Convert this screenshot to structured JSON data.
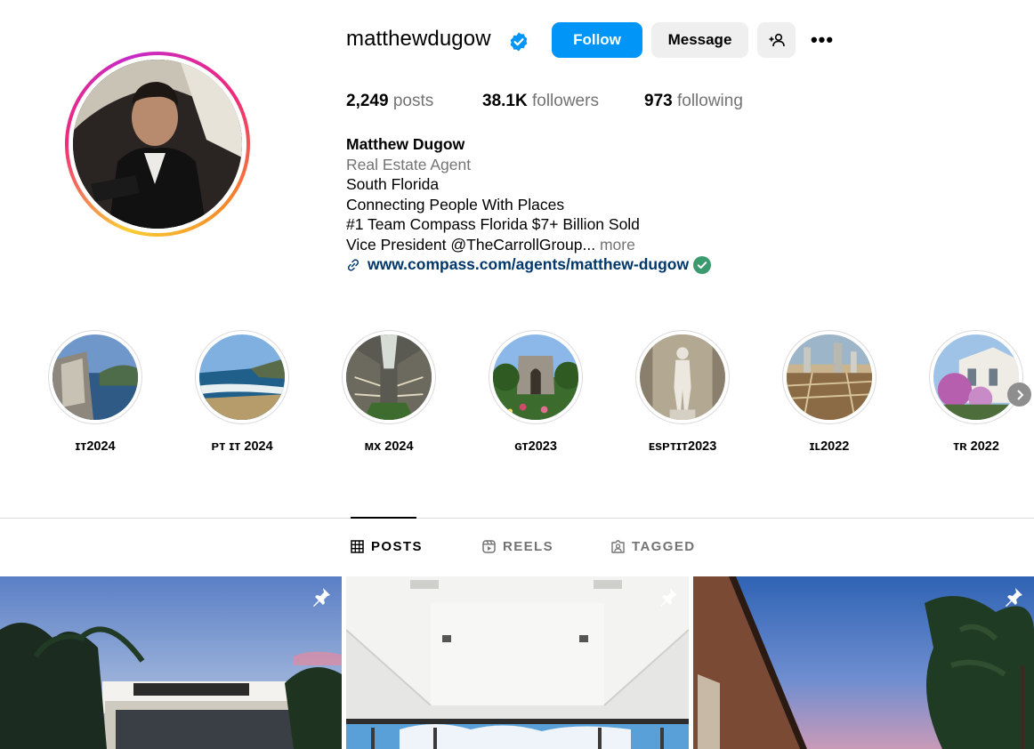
{
  "profile": {
    "username": "matthewdugow",
    "follow_label": "Follow",
    "message_label": "Message",
    "more_label": "•••",
    "stats": {
      "posts_count": "2,249",
      "posts_label": "posts",
      "followers_count": "38.1K",
      "followers_label": "followers",
      "following_count": "973",
      "following_label": "following"
    },
    "bio": {
      "name": "Matthew Dugow",
      "category": "Real Estate Agent",
      "line1": "South Florida",
      "line2": "Connecting People With Places",
      "line3": "#1 Team Compass Florida $7+ Billion Sold",
      "line4": "Vice President @TheCarrollGroup...",
      "more_label": "more",
      "link": "www.compass.com/agents/matthew-dugow"
    }
  },
  "highlights": [
    {
      "label": "ɪᴛ2024"
    },
    {
      "label": "ᴘᴛ ɪᴛ 2024"
    },
    {
      "label": "ᴍx 2024"
    },
    {
      "label": "ɢᴛ2023"
    },
    {
      "label": "ᴇsᴘᴛɪᴛ2023"
    },
    {
      "label": "ɪʟ2022"
    },
    {
      "label": "ᴛʀ 2022"
    }
  ],
  "tabs": {
    "posts": "POSTS",
    "reels": "REELS",
    "tagged": "TAGGED"
  },
  "colors": {
    "follow_blue": "#0095f6",
    "link_blue": "#00376b",
    "verified_blue": "#0095f6",
    "secondary_gray": "#737373"
  }
}
